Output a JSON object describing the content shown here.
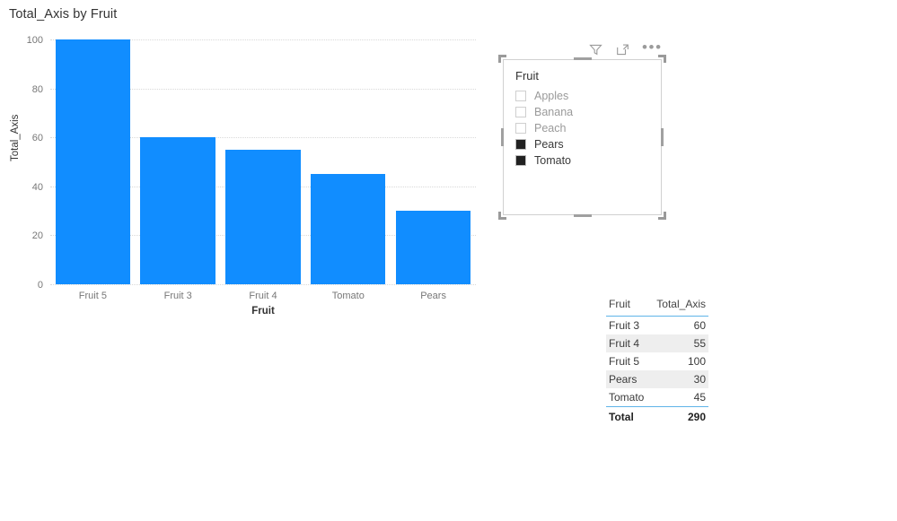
{
  "chart_visual": {
    "title": "Total_Axis by Fruit",
    "xaxis_title": "Fruit",
    "yaxis_title": "Total_Axis"
  },
  "chart_data": {
    "type": "bar",
    "title": "Total_Axis by Fruit",
    "xlabel": "Fruit",
    "ylabel": "Total_Axis",
    "categories": [
      "Fruit 5",
      "Fruit 3",
      "Fruit 4",
      "Tomato",
      "Pears"
    ],
    "values": [
      100,
      60,
      55,
      45,
      30
    ],
    "ylim": [
      0,
      100
    ],
    "yticks": [
      0,
      20,
      40,
      60,
      80,
      100
    ],
    "grid": true,
    "legend": false,
    "bar_color": "#118DFF"
  },
  "slicer": {
    "header": "Fruit",
    "items": [
      {
        "label": "Apples",
        "checked": false
      },
      {
        "label": "Banana",
        "checked": false
      },
      {
        "label": "Peach",
        "checked": false
      },
      {
        "label": "Pears",
        "checked": true
      },
      {
        "label": "Tomato",
        "checked": true
      }
    ],
    "icons": [
      {
        "name": "filter-icon"
      },
      {
        "name": "focus-mode-icon"
      },
      {
        "name": "more-options-icon",
        "glyph": "•••"
      }
    ]
  },
  "table_visual": {
    "columns": [
      "Fruit",
      "Total_Axis"
    ],
    "rows": [
      {
        "fruit": "Fruit 3",
        "total_axis": "60"
      },
      {
        "fruit": "Fruit 4",
        "total_axis": "55"
      },
      {
        "fruit": "Fruit 5",
        "total_axis": "100"
      },
      {
        "fruit": "Pears",
        "total_axis": "30"
      },
      {
        "fruit": "Tomato",
        "total_axis": "45"
      }
    ],
    "total_row": {
      "label": "Total",
      "value": "290"
    }
  }
}
